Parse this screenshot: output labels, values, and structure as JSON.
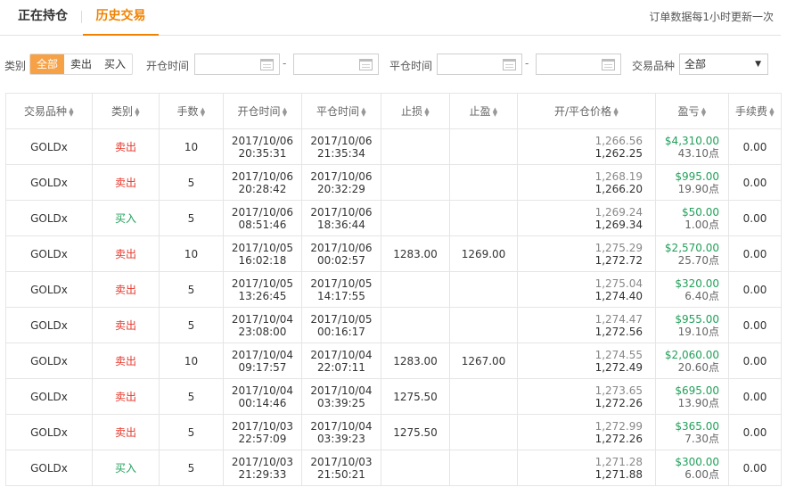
{
  "tabs": [
    {
      "label": "正在持仓",
      "active": false
    },
    {
      "label": "历史交易",
      "active": true
    }
  ],
  "notice": "订单数据每1小时更新一次",
  "filters": {
    "type_label": "类别",
    "type_options": [
      "全部",
      "卖出",
      "买入"
    ],
    "type_selected": "全部",
    "open_time_label": "开仓时间",
    "close_time_label": "平仓时间",
    "range_sep": "-",
    "symbol_label": "交易品种",
    "symbol_value": "全部"
  },
  "table": {
    "headers": [
      "交易品种",
      "类别",
      "手数",
      "开仓时间",
      "平仓时间",
      "止损",
      "止盈",
      "开/平仓价格",
      "盈亏",
      "手续费"
    ],
    "rows": [
      {
        "symbol": "GOLDx",
        "type": "卖出",
        "side": "sell",
        "lots": "10",
        "open_date": "2017/10/06",
        "open_time": "20:35:31",
        "close_date": "2017/10/06",
        "close_time": "21:35:34",
        "sl": "",
        "tp": "",
        "open_price": "1,266.56",
        "close_price": "1,262.25",
        "pnl": "$4,310.00",
        "points": "43.10点",
        "fee": "0.00"
      },
      {
        "symbol": "GOLDx",
        "type": "卖出",
        "side": "sell",
        "lots": "5",
        "open_date": "2017/10/06",
        "open_time": "20:28:42",
        "close_date": "2017/10/06",
        "close_time": "20:32:29",
        "sl": "",
        "tp": "",
        "open_price": "1,268.19",
        "close_price": "1,266.20",
        "pnl": "$995.00",
        "points": "19.90点",
        "fee": "0.00"
      },
      {
        "symbol": "GOLDx",
        "type": "买入",
        "side": "buy",
        "lots": "5",
        "open_date": "2017/10/06",
        "open_time": "08:51:46",
        "close_date": "2017/10/06",
        "close_time": "18:36:44",
        "sl": "",
        "tp": "",
        "open_price": "1,269.24",
        "close_price": "1,269.34",
        "pnl": "$50.00",
        "points": "1.00点",
        "fee": "0.00"
      },
      {
        "symbol": "GOLDx",
        "type": "卖出",
        "side": "sell",
        "lots": "10",
        "open_date": "2017/10/05",
        "open_time": "16:02:18",
        "close_date": "2017/10/06",
        "close_time": "00:02:57",
        "sl": "1283.00",
        "tp": "1269.00",
        "open_price": "1,275.29",
        "close_price": "1,272.72",
        "pnl": "$2,570.00",
        "points": "25.70点",
        "fee": "0.00"
      },
      {
        "symbol": "GOLDx",
        "type": "卖出",
        "side": "sell",
        "lots": "5",
        "open_date": "2017/10/05",
        "open_time": "13:26:45",
        "close_date": "2017/10/05",
        "close_time": "14:17:55",
        "sl": "",
        "tp": "",
        "open_price": "1,275.04",
        "close_price": "1,274.40",
        "pnl": "$320.00",
        "points": "6.40点",
        "fee": "0.00"
      },
      {
        "symbol": "GOLDx",
        "type": "卖出",
        "side": "sell",
        "lots": "5",
        "open_date": "2017/10/04",
        "open_time": "23:08:00",
        "close_date": "2017/10/05",
        "close_time": "00:16:17",
        "sl": "",
        "tp": "",
        "open_price": "1,274.47",
        "close_price": "1,272.56",
        "pnl": "$955.00",
        "points": "19.10点",
        "fee": "0.00"
      },
      {
        "symbol": "GOLDx",
        "type": "卖出",
        "side": "sell",
        "lots": "10",
        "open_date": "2017/10/04",
        "open_time": "09:17:57",
        "close_date": "2017/10/04",
        "close_time": "22:07:11",
        "sl": "1283.00",
        "tp": "1267.00",
        "open_price": "1,274.55",
        "close_price": "1,272.49",
        "pnl": "$2,060.00",
        "points": "20.60点",
        "fee": "0.00"
      },
      {
        "symbol": "GOLDx",
        "type": "卖出",
        "side": "sell",
        "lots": "5",
        "open_date": "2017/10/04",
        "open_time": "00:14:46",
        "close_date": "2017/10/04",
        "close_time": "03:39:25",
        "sl": "1275.50",
        "tp": "",
        "open_price": "1,273.65",
        "close_price": "1,272.26",
        "pnl": "$695.00",
        "points": "13.90点",
        "fee": "0.00"
      },
      {
        "symbol": "GOLDx",
        "type": "卖出",
        "side": "sell",
        "lots": "5",
        "open_date": "2017/10/03",
        "open_time": "22:57:09",
        "close_date": "2017/10/04",
        "close_time": "03:39:23",
        "sl": "1275.50",
        "tp": "",
        "open_price": "1,272.99",
        "close_price": "1,272.26",
        "pnl": "$365.00",
        "points": "7.30点",
        "fee": "0.00"
      },
      {
        "symbol": "GOLDx",
        "type": "买入",
        "side": "buy",
        "lots": "5",
        "open_date": "2017/10/03",
        "open_time": "21:29:33",
        "close_date": "2017/10/03",
        "close_time": "21:50:21",
        "sl": "",
        "tp": "",
        "open_price": "1,271.28",
        "close_price": "1,271.88",
        "pnl": "$300.00",
        "points": "6.00点",
        "fee": "0.00"
      }
    ]
  },
  "colors": {
    "accent": "#f08200",
    "active_bg": "#f6a146",
    "sell": "#e5372b",
    "buy": "#22a05a",
    "profit": "#22a05a"
  }
}
